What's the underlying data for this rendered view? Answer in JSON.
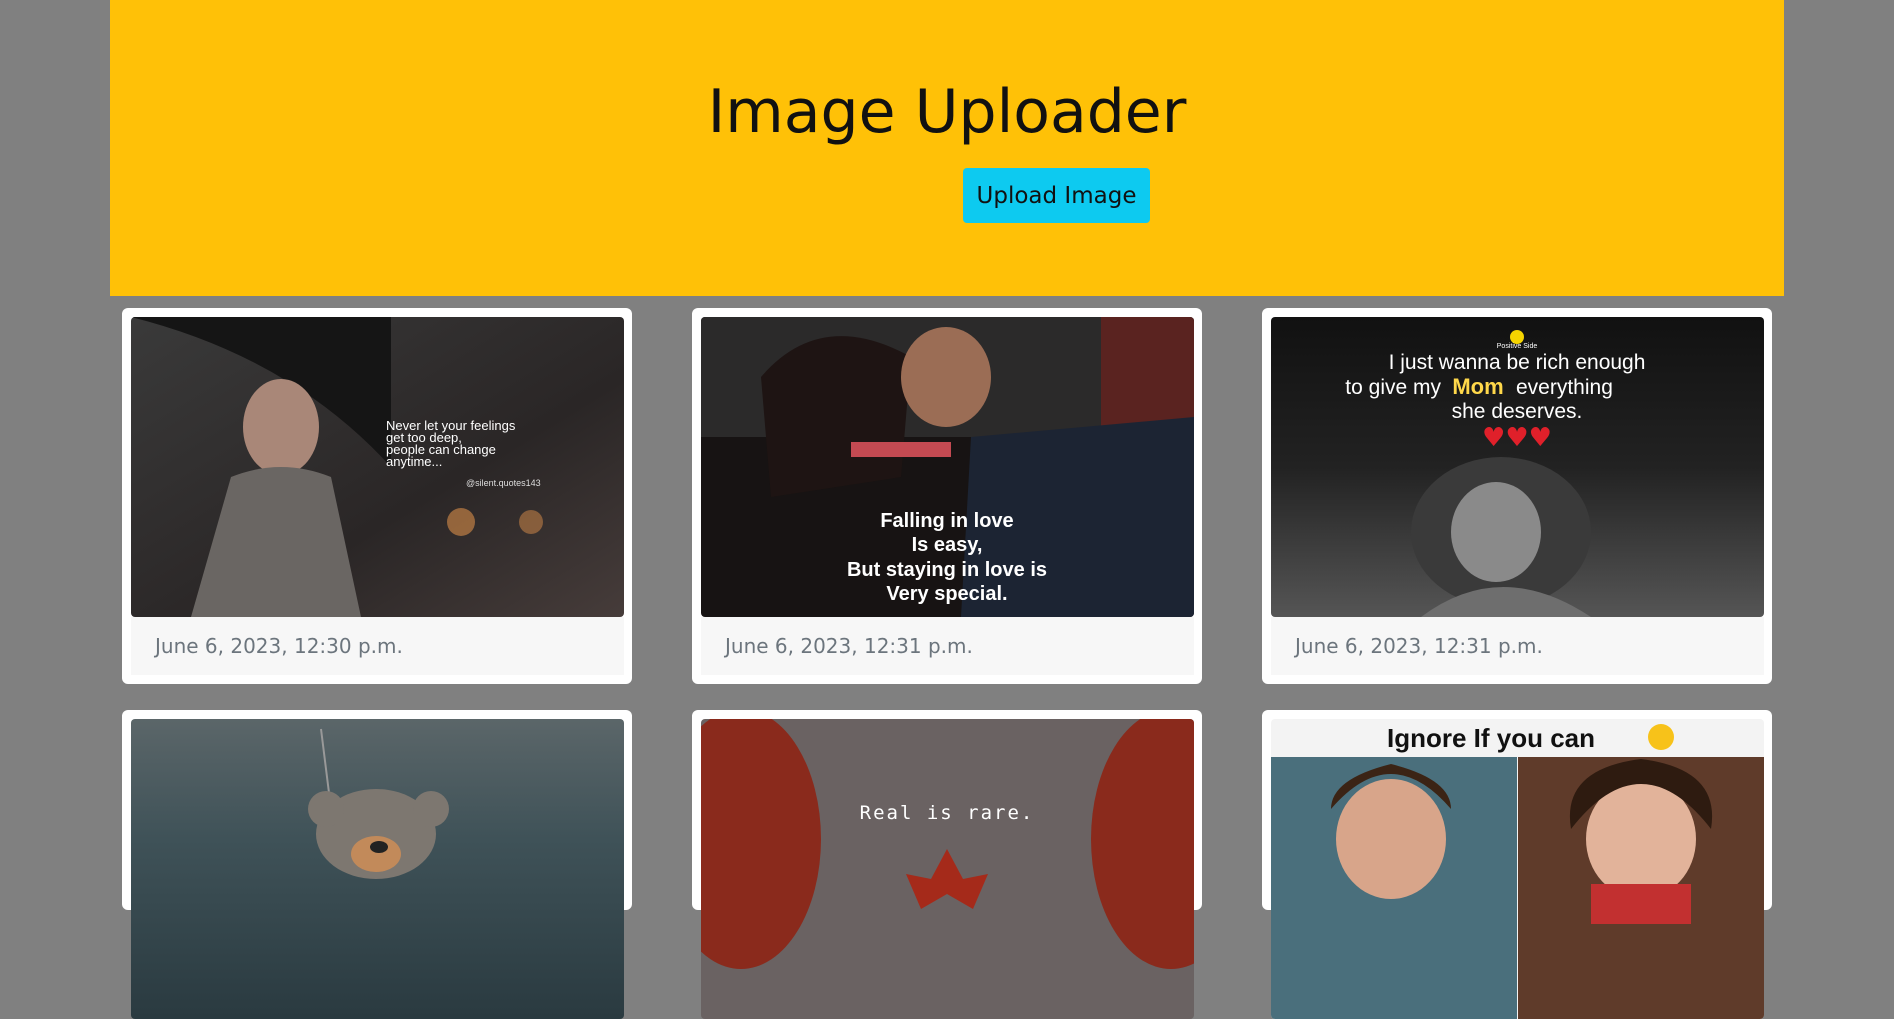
{
  "hero": {
    "title": "Image Uploader",
    "upload_label": "Upload Image"
  },
  "colors": {
    "background": "#808080",
    "hero_bg": "#ffc107",
    "button_bg": "#0dcaf0"
  },
  "cards": [
    {
      "date": "June 6, 2023, 12:30 p.m.",
      "caption_lines": [
        "Never let your feelings",
        "get too deep,",
        "people can change",
        "anytime..."
      ],
      "handle": "@silent.quotes143"
    },
    {
      "date": "June 6, 2023, 12:31 p.m.",
      "caption_lines": [
        "Falling in love",
        "Is easy,",
        "But staying in love is",
        "Very special."
      ]
    },
    {
      "date": "June 6, 2023, 12:31 p.m.",
      "brand": "Positive Side",
      "caption_lines": [
        "I just wanna be rich enough",
        "everything",
        "she deserves."
      ],
      "caption_prefix": "to give my",
      "caption_highlight": "Mom"
    },
    {
      "date": ""
    },
    {
      "date": "",
      "caption_lines": [
        "Real is rare."
      ]
    },
    {
      "date": "",
      "caption_lines": [
        "Ignore If you can"
      ]
    }
  ]
}
